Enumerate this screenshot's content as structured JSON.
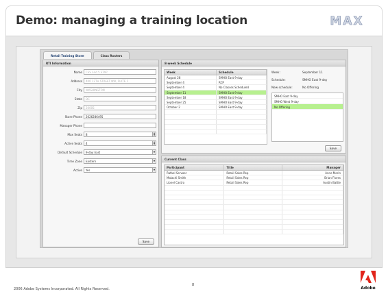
{
  "slide": {
    "title": "Demo: managing a training location",
    "logo_text": "MAX",
    "footer_copyright": "2006 Adobe Systems Incorporated.  All Rights Reserved.",
    "page_number": "8",
    "adobe_label": "Adobe"
  },
  "tabs": [
    {
      "label": "Retail Training Store"
    },
    {
      "label": "Class Rosters"
    }
  ],
  "rti": {
    "header": "RTI Information",
    "fields": [
      {
        "label": "Name",
        "value": "CSS and 5 STAP",
        "faded": true
      },
      {
        "label": "Address",
        "value": "400 12TH STREET NW, SUITE 1",
        "faded": true
      },
      {
        "label": "City",
        "value": "WASHINGTON",
        "faded": true
      },
      {
        "label": "State",
        "value": "DC",
        "faded": true
      },
      {
        "label": "Zip",
        "value": "20005",
        "faded": true
      },
      {
        "label": "Store Phone",
        "value": "2026286495",
        "faded": false
      },
      {
        "label": "Manager Phone",
        "value": "",
        "faded": false
      },
      {
        "label": "Max Seats",
        "value": "8",
        "faded": false
      },
      {
        "label": "Active Seats",
        "value": "4",
        "faded": false
      },
      {
        "label": "Default Schedule",
        "value": "9-day East",
        "faded": false
      },
      {
        "label": "Time Zone",
        "value": "Eastern",
        "faded": false
      },
      {
        "label": "Active",
        "value": "Yes",
        "faded": false
      }
    ],
    "save_label": "Save"
  },
  "schedule": {
    "header": "8-week Schedule",
    "columns": [
      "Week",
      "Schedule"
    ],
    "rows": [
      {
        "week": "August 28",
        "schedule": "SMHO East 9-day",
        "selected": false
      },
      {
        "week": "September 4",
        "schedule": "RCP",
        "selected": false
      },
      {
        "week": "September 4",
        "schedule": "No Classes Scheduled",
        "selected": false
      },
      {
        "week": "September 11",
        "schedule": "SMHO East 9-day",
        "selected": true
      },
      {
        "week": "September 18",
        "schedule": "SMHO East 9-day",
        "selected": false
      },
      {
        "week": "September 25",
        "schedule": "SMHO East 9-day",
        "selected": false
      },
      {
        "week": "October 2",
        "schedule": "SMHO East 9-day",
        "selected": false
      }
    ],
    "detail": {
      "week_label": "Week:",
      "week_value": "September 11",
      "schedule_label": "Schedule:",
      "schedule_value": "SMHO East 9-day",
      "new_schedule_label": "New schedule:",
      "new_schedule_value": "No Offering"
    },
    "options": [
      {
        "label": "SMHO East 9-day",
        "selected": false
      },
      {
        "label": "SMHO West 9-day",
        "selected": false
      },
      {
        "label": "No Offering",
        "selected": true
      }
    ],
    "save_label": "Save"
  },
  "current_class": {
    "header": "Current Class",
    "columns": [
      "Participant",
      "Title",
      "Manager"
    ],
    "rows": [
      {
        "participant": "Rafael Servoor",
        "title": "Retail Sales Rep",
        "manager": "Anne Morin"
      },
      {
        "participant": "Malachi Smith",
        "title": "Retail Sales Rep",
        "manager": "Brian Flores"
      },
      {
        "participant": "Lionel Castro",
        "title": "Retail Sales Rep",
        "manager": "Austin Battle"
      }
    ]
  },
  "colors": {
    "selection": "#b7f08f",
    "title_text": "#333333",
    "adobe_red": "#e1251b"
  }
}
